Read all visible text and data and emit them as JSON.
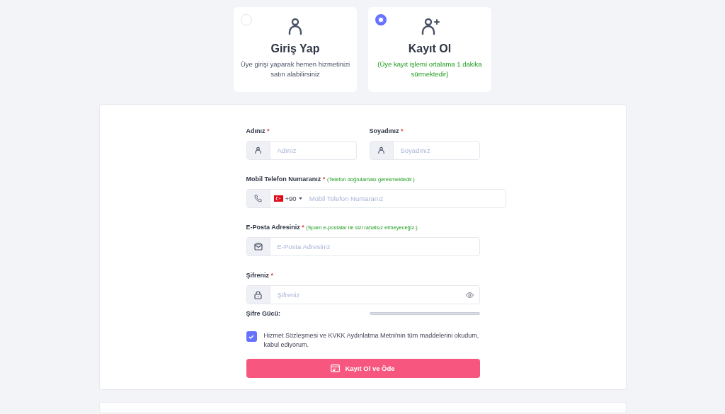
{
  "options": [
    {
      "title": "Giriş Yap",
      "subtitle": "Üye girişi yaparak hemen hizmetinizi satın alabilirsiniz",
      "selected": false,
      "kind": "login"
    },
    {
      "title": "Kayıt Ol",
      "subtitle": "(Üye kayıt işlemi ortalama 1 dakika sürmektedir)",
      "selected": true,
      "kind": "register"
    }
  ],
  "form": {
    "rows": [
      [
        {
          "label": "Adınız",
          "required": "*",
          "placeholder": "Adınız",
          "kind": "person"
        },
        {
          "label": "Soyadınız",
          "required": "*",
          "placeholder": "Soyadınız",
          "kind": "person"
        }
      ],
      [
        {
          "label": "Mobil Telefon Numaranız",
          "required": "*",
          "note": "(Telefon doğrulaması gerekmektedir.)",
          "placeholder": "Mobil Telefon Numaranız",
          "kind": "phone",
          "dial_code": "+90"
        }
      ],
      [
        {
          "label": "E-Posta Adresiniz",
          "required": "*",
          "note": "(Spam e-postalar ile sizi rahatsız etmeyeceğiz.)",
          "placeholder": "E-Posta Adresiniz",
          "kind": "email"
        }
      ],
      [
        {
          "label": "Şifreniz",
          "required": "*",
          "placeholder": "Şifreniz",
          "kind": "password"
        }
      ]
    ],
    "strength_label": "Şifre Gücü:",
    "consent": {
      "text": "Hizmet Sözleşmesi ve KVKK Aydınlatma Metni'nin tüm maddelerini okudum, kabul ediyorum.",
      "checked": true
    },
    "submit": "Kayıt Ol ve Öde"
  }
}
